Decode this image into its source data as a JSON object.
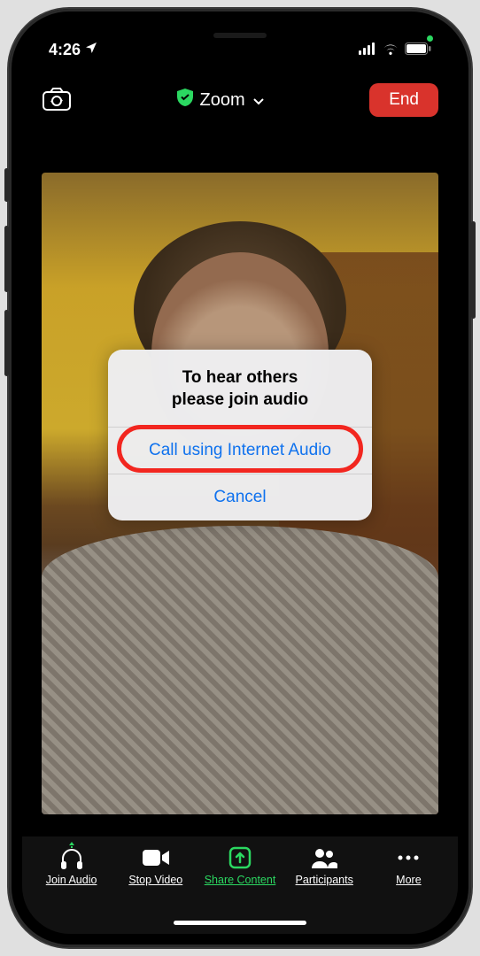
{
  "status": {
    "time": "4:26",
    "location_icon": "location-arrow"
  },
  "nav": {
    "app_title": "Zoom",
    "end_label": "End"
  },
  "dialog": {
    "title_line1": "To hear others",
    "title_line2": "please join audio",
    "primary_action": "Call using Internet Audio",
    "cancel_action": "Cancel"
  },
  "tabs": {
    "join_audio": "Join Audio",
    "stop_video": "Stop Video",
    "share_content": "Share Content",
    "participants": "Participants",
    "more": "More"
  }
}
